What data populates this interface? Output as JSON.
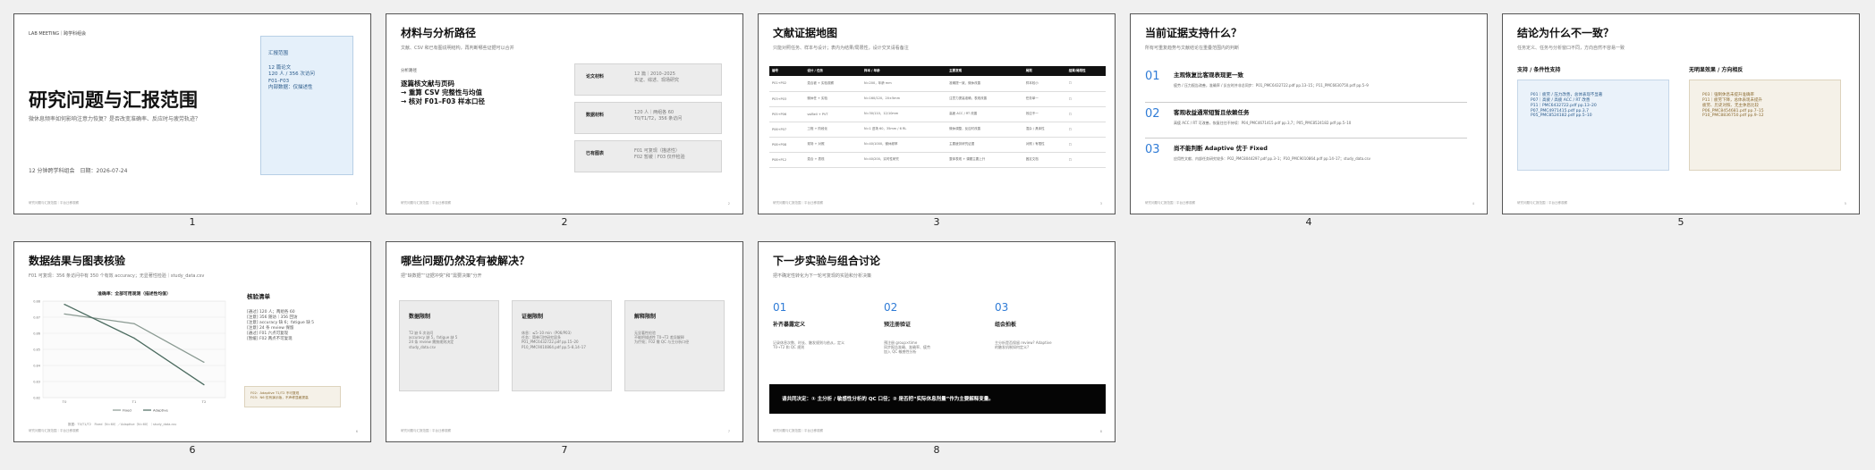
{
  "footer_text": "研究问题与汇报范围｜平台迁移观察",
  "slides": {
    "s1": {
      "number": "1",
      "kicker": "LAB MEETING｜跨学科组会",
      "title": "研究问题与汇报范围",
      "subtitle": "微休息频率如何影响注意力恢复？是否改变准确率、反应时与疲劳轨迹？",
      "meta": "12 分钟跨学科组会　日期：2026-07-24",
      "scope_title": "汇报范围",
      "scope_lines": [
        "12 篇论文",
        "120 人 / 356 次访问",
        "F01–F03",
        "内部数据：仅描述性"
      ],
      "page": "1"
    },
    "s2": {
      "number": "2",
      "title": "材料与分析路径",
      "subtitle": "文献、CSV 和已有图说明结构，再判断哪些证据可以合并",
      "path_label": "分析路径",
      "path_lines": [
        "逐篇核文献与页码",
        "→ 重算 CSV 完整性与均值",
        "→ 核对 F01–F03 样本口径"
      ],
      "cards": [
        {
          "label": "论文材料",
          "lines": [
            "12 篇｜2010–2025",
            "实证、综述、现场研究"
          ]
        },
        {
          "label": "数据材料",
          "lines": [
            "120 人｜两组各 60",
            "T0/T1/T2，356 条访问"
          ]
        },
        {
          "label": "已有图表",
          "lines": [
            "F01 可复现（描述性）",
            "F02 暂缓｜F03 仅作检验"
          ]
        }
      ],
      "page": "2"
    },
    "s3": {
      "number": "3",
      "title": "文献证据地图",
      "subtitle": "只能对照任务、样本与设计；表内为结果/局限性，设计交叉请看备注",
      "headers": [
        "编号",
        "设计 / 任务",
        "样本 / 年龄",
        "主要发现",
        "局限",
        "结果/局限性"
      ],
      "rows": [
        [
          "P01+P02",
          "混合被 + 实验观察",
          "N=200，年龄 mm",
          "准确提一致，微休改善",
          "样本较小",
          "☐"
        ],
        [
          "P03+P03",
          "微休任 + 实验",
          "N=160/120，20±5mm",
          "注意力提高准确，表现改善",
          "任务单一",
          "☐"
        ],
        [
          "P05+P06",
          "vsiBell + PVT",
          "N=30/110，12/10mm",
          "高疲 ACC / RT 改善",
          "效应不一",
          "☐"
        ],
        [
          "P06+P07",
          "工程 + 阶段化",
          "N=1 进场 60，35mm / 6 RL",
          "微休调整，反应时改善",
          "混杂 / 具体性",
          "☐"
        ],
        [
          "P08+P08",
          "现场 + 对照",
          "N=40/1000，微休频率",
          "主要疲劳研究证据",
          "对照 / 有限性",
          "☐"
        ],
        [
          "P08+P12",
          "混合 + 表现",
          "N=40/200，实时性研究",
          "整体表现 + 课题主要上升",
          "固定文档",
          "☐"
        ]
      ],
      "page": "3"
    },
    "s4": {
      "number": "4",
      "title": "当前证据支持什么？",
      "subtitle": "所有可重复趋势与文献结论在重叠范围内的判断",
      "items": [
        {
          "num": "01",
          "head": "主观恢复比客观表现更一致",
          "body": "疲劳 / 压力报告改善，准确率 / 反应时并非总同步：P01_PMC6432722.pdf pp.13–15；P11_PMC6630750.pdf pp.5–9"
        },
        {
          "num": "02",
          "head": "客观收益通常短暂且依赖任务",
          "body": "高疲 ACC / RT 可改善，恢复往往不持续：P04_PMC4671415.pdf pp.3,7；P05_PMC8524182.pdf pp.5–10"
        },
        {
          "num": "03",
          "head": "尚不能判断 Adaptive 优于 Fixed",
          "body": "应用性文献、内部任务研究较多：P02_PMC8044297.pdf pp.3–1；P10_PMC9010864.pdf pp.14–17；study_data.csv"
        }
      ],
      "page": "4"
    },
    "s5": {
      "number": "5",
      "title": "结论为什么不一致？",
      "subtitle": "任务定义、任务与分析窗口不同，方向自然不容易一致",
      "support_title": "支持 / 条件性支持",
      "support_lines": [
        "P01｜疲劳 / 压力改善，总体表现不显著",
        "P07｜高疲 / 高疲 ACC / RT 改善",
        "P11｜PMC6432722.pdf pp.13–20",
        "P07_PMC4971415.pdf pp.3,7",
        "P05_PMC8524182.pdf pp.5–10"
      ],
      "oppose_title": "无明显效果 / 方向相反",
      "oppose_lines": [
        "P03｜强制休息未提升准确率",
        "P11｜疲劳下降，总体表现未提升",
        "疲劳、历史对照、无主休息比较",
        "P06_PMC8454681.pdf pp.7–15",
        "P10_PMC8836750.pdf pp.9–12"
      ],
      "page": "5"
    },
    "s6": {
      "number": "6",
      "title": "数据结果与图表核验",
      "subtitle": "F01 可复现：356 条访问中有 350 个有效 accuracy；无显著性检验｜study_data.csv",
      "chart_title": "准确率：全部可用观测（描述性均值）",
      "checklist_title": "核验清单",
      "checklist": [
        "[通过] 120 人；两组各 60",
        "[注意] 356 随访｜356 回访",
        "[注意] accuracy 缺 6；fatigue 缺 5",
        "[注意] 24 条 review 保留",
        "[通过] F01 六点可复现",
        "[暂缓] F02 两点不可复现"
      ],
      "note_lines": [
        "F02：Adaptive T1/T2 不可复现",
        "F03：N6 仅有演示版，不声称显著提高"
      ],
      "source": "数据：T0/T1/T2　Fixed（N=60）／Adaptive（N=60）｜study_data.csv",
      "page": "6"
    },
    "s7": {
      "number": "7",
      "title": "哪些问题仍然没有被解决？",
      "subtitle": "把“缺数据”“证据冲突”和“需要决策”分开",
      "cards": [
        {
          "title": "数据限制",
          "lines": [
            "T2 缺 6 次访问",
            "accuracy 缺 5，fatigue 缺 5",
            "24 条 review 需按规则决定",
            "study_data.csv"
          ]
        },
        {
          "title": "证据限制",
          "lines": [
            "休息：≤5–10 min（P06/P03）",
            "任务：简单可控研究居多",
            "P01_PMC6432722.pdf pp.15–20",
            "P10_PMC9010864.pdf pp.5–8,14–17"
          ]
        },
        {
          "title": "解释限制",
          "lines": [
            "无显著性检验",
            "不能把描述性 T0→T2 差异解释",
            "为疗效；F02 需 QC 与主分析口径"
          ]
        }
      ],
      "page": "7"
    },
    "s8": {
      "number": "8",
      "title": "下一步实验与组合讨论",
      "subtitle": "把不确定性转化为下一轮可复现的实验和分析决策",
      "cols": [
        {
          "num": "01",
          "head": "补齐暴露定义",
          "lines": [
            "记录休息次数、时长、触发规则与依从，定义 T0→T2 和 QC 规则"
          ]
        },
        {
          "num": "02",
          "head": "预注册验证",
          "lines": [
            "预注册 group×time",
            "同步报告准确、准确率、疲劳",
            "加入 QC 敏感性分析"
          ]
        },
        {
          "num": "03",
          "head": "组会拍板",
          "lines": [
            "主分析是否保留 review? Adaptive",
            "的触发机制如何定义?"
          ]
        }
      ],
      "decision": "请共同决定：① 主分析 / 敏感性分析的 QC 口径；② 是否把“实际休息剂量”作为主要解释变量。",
      "page": "8"
    }
  },
  "chart_data": {
    "type": "line",
    "title": "准确率：全部可用观测（描述性均值）",
    "categories": [
      "T0",
      "T1",
      "T2"
    ],
    "series": [
      {
        "name": "Fixed",
        "values": [
          0.872,
          0.866,
          0.842
        ],
        "color": "#8a9a92"
      },
      {
        "name": "Adaptive",
        "values": [
          0.878,
          0.857,
          0.828
        ],
        "color": "#4b6b5f"
      }
    ],
    "yticks": [
      "0.88",
      "0.87",
      "0.86",
      "0.85",
      "0.84",
      "0.83",
      "0.82"
    ],
    "ylim": [
      0.82,
      0.88
    ],
    "grid": true,
    "legend": "bottom"
  }
}
